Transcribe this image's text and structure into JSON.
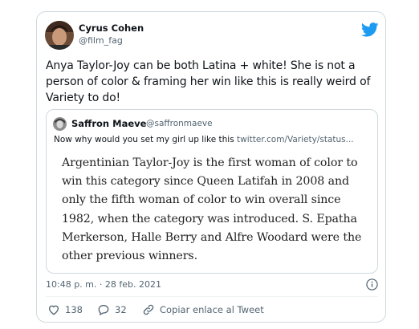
{
  "tweet": {
    "author": {
      "name": "Cyrus Cohen",
      "handle": "@film_fag"
    },
    "text": "Anya Taylor-Joy can be both Latina + white! She is not a person of color & framing her win like this is really weird of Variety to do!",
    "timestamp": "10:48 p. m. · 28 feb. 2021"
  },
  "quoted": {
    "author": {
      "name": "Saffron Maeve",
      "handle": "@saffronmaeve"
    },
    "text": "Now why would you set my girl up like this ",
    "link": "twitter.com/Variety/status...",
    "image_text": "Argentinian Taylor-Joy is the first woman of color to win this category since Queen Latifah in 2008 and only the fifth woman of color to win overall since 1982, when the category was introduced. S. Epatha Merkerson, Halle Berry and Alfre Woodard were the other previous winners."
  },
  "actions": {
    "likes": "138",
    "replies": "32",
    "copy_link": "Copiar enlace al Tweet"
  },
  "colors": {
    "brand": "#1d9bf0",
    "secondary_text": "#536471",
    "border": "#cfd9de"
  },
  "icons": [
    "twitter-bird-icon",
    "info-icon",
    "heart-icon",
    "reply-icon",
    "link-icon"
  ]
}
